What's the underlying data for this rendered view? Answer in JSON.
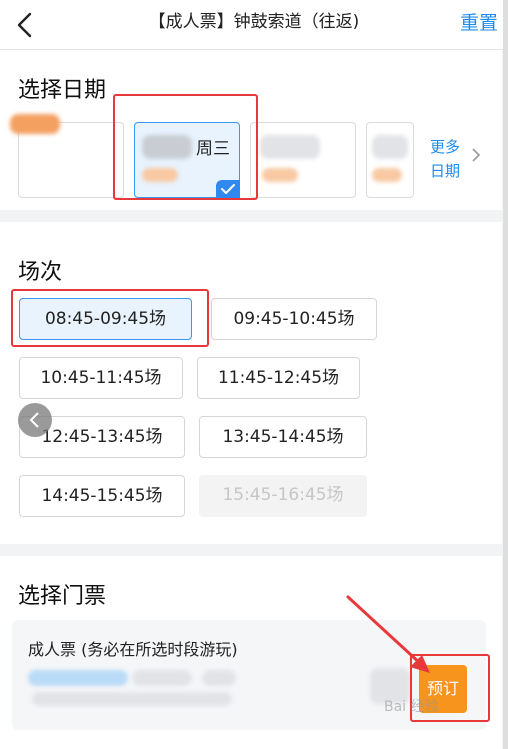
{
  "header": {
    "back_icon": "chevron-left-icon",
    "title": "【成人票】钟鼓索道（往返)",
    "reset_label": "重置"
  },
  "date_section": {
    "title": "选择日期",
    "selected_weekday": "周三",
    "more_line1": "更多",
    "more_line2": "日期",
    "more_icon": "chevron-right-icon",
    "check_icon": "check-icon"
  },
  "session_section": {
    "title": "场次",
    "sessions": [
      {
        "label": "08:45-09:45场",
        "state": "selected"
      },
      {
        "label": "09:45-10:45场",
        "state": "available"
      },
      {
        "label": "10:45-11:45场",
        "state": "available"
      },
      {
        "label": "11:45-12:45场",
        "state": "available"
      },
      {
        "label": "12:45-13:45场",
        "state": "available"
      },
      {
        "label": "13:45-14:45场",
        "state": "available"
      },
      {
        "label": "14:45-15:45场",
        "state": "available"
      },
      {
        "label": "15:45-16:45场",
        "state": "disabled"
      }
    ]
  },
  "ticket_section": {
    "title": "选择门票",
    "ticket_name": "成人票 (务必在所选时段游玩)",
    "book_label": "预订"
  },
  "watermark": "Bai 经验",
  "colors": {
    "accent": "#1b8cf0",
    "selected_bg": "#e8f3fe",
    "selected_border": "#3a96f0",
    "book_button": "#f7941d",
    "annotation": "#e8383a"
  }
}
